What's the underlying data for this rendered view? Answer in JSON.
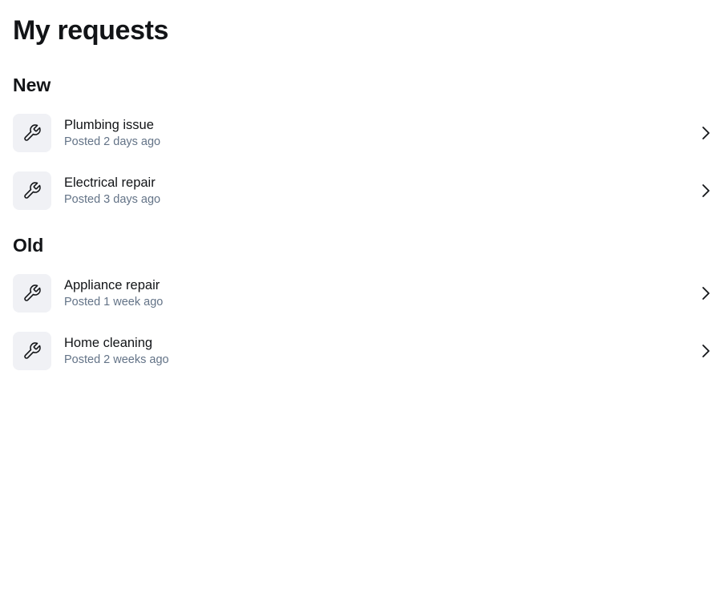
{
  "page": {
    "title": "My requests"
  },
  "sections": [
    {
      "title": "New",
      "items": [
        {
          "title": "Plumbing issue",
          "subtitle": "Posted 2 days ago",
          "icon": "wrench-icon"
        },
        {
          "title": "Electrical repair",
          "subtitle": "Posted 3 days ago",
          "icon": "wrench-icon"
        }
      ]
    },
    {
      "title": "Old",
      "items": [
        {
          "title": "Appliance repair",
          "subtitle": "Posted 1 week ago",
          "icon": "wrench-icon"
        },
        {
          "title": "Home cleaning",
          "subtitle": "Posted 2 weeks ago",
          "icon": "wrench-icon"
        }
      ]
    }
  ],
  "colors": {
    "text_primary": "#121417",
    "text_secondary": "#637387",
    "icon_background": "#f0f1f5"
  }
}
